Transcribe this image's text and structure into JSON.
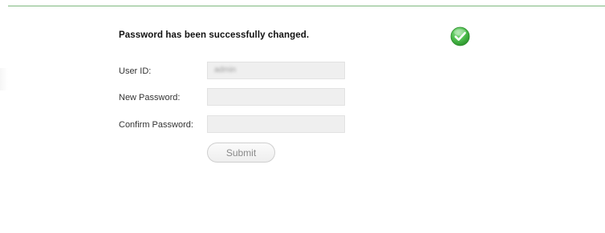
{
  "message": {
    "text": "Password has been successfully changed.",
    "status_icon": "check-circle-icon",
    "status_color": "#3aa83a"
  },
  "form": {
    "user_id": {
      "label": "User ID:",
      "value": "admin"
    },
    "new_password": {
      "label": "New Password:",
      "value": ""
    },
    "confirm_password": {
      "label": "Confirm Password:",
      "value": ""
    },
    "submit_label": "Submit"
  },
  "colors": {
    "top_rule": "#7fb97f",
    "input_background": "#efefef"
  }
}
